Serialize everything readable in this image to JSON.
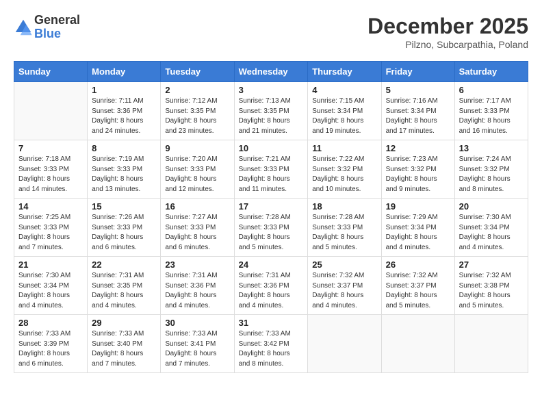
{
  "logo": {
    "general": "General",
    "blue": "Blue"
  },
  "title": "December 2025",
  "location": "Pilzno, Subcarpathia, Poland",
  "days_header": [
    "Sunday",
    "Monday",
    "Tuesday",
    "Wednesday",
    "Thursday",
    "Friday",
    "Saturday"
  ],
  "weeks": [
    [
      {
        "day": "",
        "info": ""
      },
      {
        "day": "1",
        "info": "Sunrise: 7:11 AM\nSunset: 3:36 PM\nDaylight: 8 hours\nand 24 minutes."
      },
      {
        "day": "2",
        "info": "Sunrise: 7:12 AM\nSunset: 3:35 PM\nDaylight: 8 hours\nand 23 minutes."
      },
      {
        "day": "3",
        "info": "Sunrise: 7:13 AM\nSunset: 3:35 PM\nDaylight: 8 hours\nand 21 minutes."
      },
      {
        "day": "4",
        "info": "Sunrise: 7:15 AM\nSunset: 3:34 PM\nDaylight: 8 hours\nand 19 minutes."
      },
      {
        "day": "5",
        "info": "Sunrise: 7:16 AM\nSunset: 3:34 PM\nDaylight: 8 hours\nand 17 minutes."
      },
      {
        "day": "6",
        "info": "Sunrise: 7:17 AM\nSunset: 3:33 PM\nDaylight: 8 hours\nand 16 minutes."
      }
    ],
    [
      {
        "day": "7",
        "info": "Sunrise: 7:18 AM\nSunset: 3:33 PM\nDaylight: 8 hours\nand 14 minutes."
      },
      {
        "day": "8",
        "info": "Sunrise: 7:19 AM\nSunset: 3:33 PM\nDaylight: 8 hours\nand 13 minutes."
      },
      {
        "day": "9",
        "info": "Sunrise: 7:20 AM\nSunset: 3:33 PM\nDaylight: 8 hours\nand 12 minutes."
      },
      {
        "day": "10",
        "info": "Sunrise: 7:21 AM\nSunset: 3:33 PM\nDaylight: 8 hours\nand 11 minutes."
      },
      {
        "day": "11",
        "info": "Sunrise: 7:22 AM\nSunset: 3:32 PM\nDaylight: 8 hours\nand 10 minutes."
      },
      {
        "day": "12",
        "info": "Sunrise: 7:23 AM\nSunset: 3:32 PM\nDaylight: 8 hours\nand 9 minutes."
      },
      {
        "day": "13",
        "info": "Sunrise: 7:24 AM\nSunset: 3:32 PM\nDaylight: 8 hours\nand 8 minutes."
      }
    ],
    [
      {
        "day": "14",
        "info": "Sunrise: 7:25 AM\nSunset: 3:33 PM\nDaylight: 8 hours\nand 7 minutes."
      },
      {
        "day": "15",
        "info": "Sunrise: 7:26 AM\nSunset: 3:33 PM\nDaylight: 8 hours\nand 6 minutes."
      },
      {
        "day": "16",
        "info": "Sunrise: 7:27 AM\nSunset: 3:33 PM\nDaylight: 8 hours\nand 6 minutes."
      },
      {
        "day": "17",
        "info": "Sunrise: 7:28 AM\nSunset: 3:33 PM\nDaylight: 8 hours\nand 5 minutes."
      },
      {
        "day": "18",
        "info": "Sunrise: 7:28 AM\nSunset: 3:33 PM\nDaylight: 8 hours\nand 5 minutes."
      },
      {
        "day": "19",
        "info": "Sunrise: 7:29 AM\nSunset: 3:34 PM\nDaylight: 8 hours\nand 4 minutes."
      },
      {
        "day": "20",
        "info": "Sunrise: 7:30 AM\nSunset: 3:34 PM\nDaylight: 8 hours\nand 4 minutes."
      }
    ],
    [
      {
        "day": "21",
        "info": "Sunrise: 7:30 AM\nSunset: 3:34 PM\nDaylight: 8 hours\nand 4 minutes."
      },
      {
        "day": "22",
        "info": "Sunrise: 7:31 AM\nSunset: 3:35 PM\nDaylight: 8 hours\nand 4 minutes."
      },
      {
        "day": "23",
        "info": "Sunrise: 7:31 AM\nSunset: 3:36 PM\nDaylight: 8 hours\nand 4 minutes."
      },
      {
        "day": "24",
        "info": "Sunrise: 7:31 AM\nSunset: 3:36 PM\nDaylight: 8 hours\nand 4 minutes."
      },
      {
        "day": "25",
        "info": "Sunrise: 7:32 AM\nSunset: 3:37 PM\nDaylight: 8 hours\nand 4 minutes."
      },
      {
        "day": "26",
        "info": "Sunrise: 7:32 AM\nSunset: 3:37 PM\nDaylight: 8 hours\nand 5 minutes."
      },
      {
        "day": "27",
        "info": "Sunrise: 7:32 AM\nSunset: 3:38 PM\nDaylight: 8 hours\nand 5 minutes."
      }
    ],
    [
      {
        "day": "28",
        "info": "Sunrise: 7:33 AM\nSunset: 3:39 PM\nDaylight: 8 hours\nand 6 minutes."
      },
      {
        "day": "29",
        "info": "Sunrise: 7:33 AM\nSunset: 3:40 PM\nDaylight: 8 hours\nand 7 minutes."
      },
      {
        "day": "30",
        "info": "Sunrise: 7:33 AM\nSunset: 3:41 PM\nDaylight: 8 hours\nand 7 minutes."
      },
      {
        "day": "31",
        "info": "Sunrise: 7:33 AM\nSunset: 3:42 PM\nDaylight: 8 hours\nand 8 minutes."
      },
      {
        "day": "",
        "info": ""
      },
      {
        "day": "",
        "info": ""
      },
      {
        "day": "",
        "info": ""
      }
    ]
  ]
}
